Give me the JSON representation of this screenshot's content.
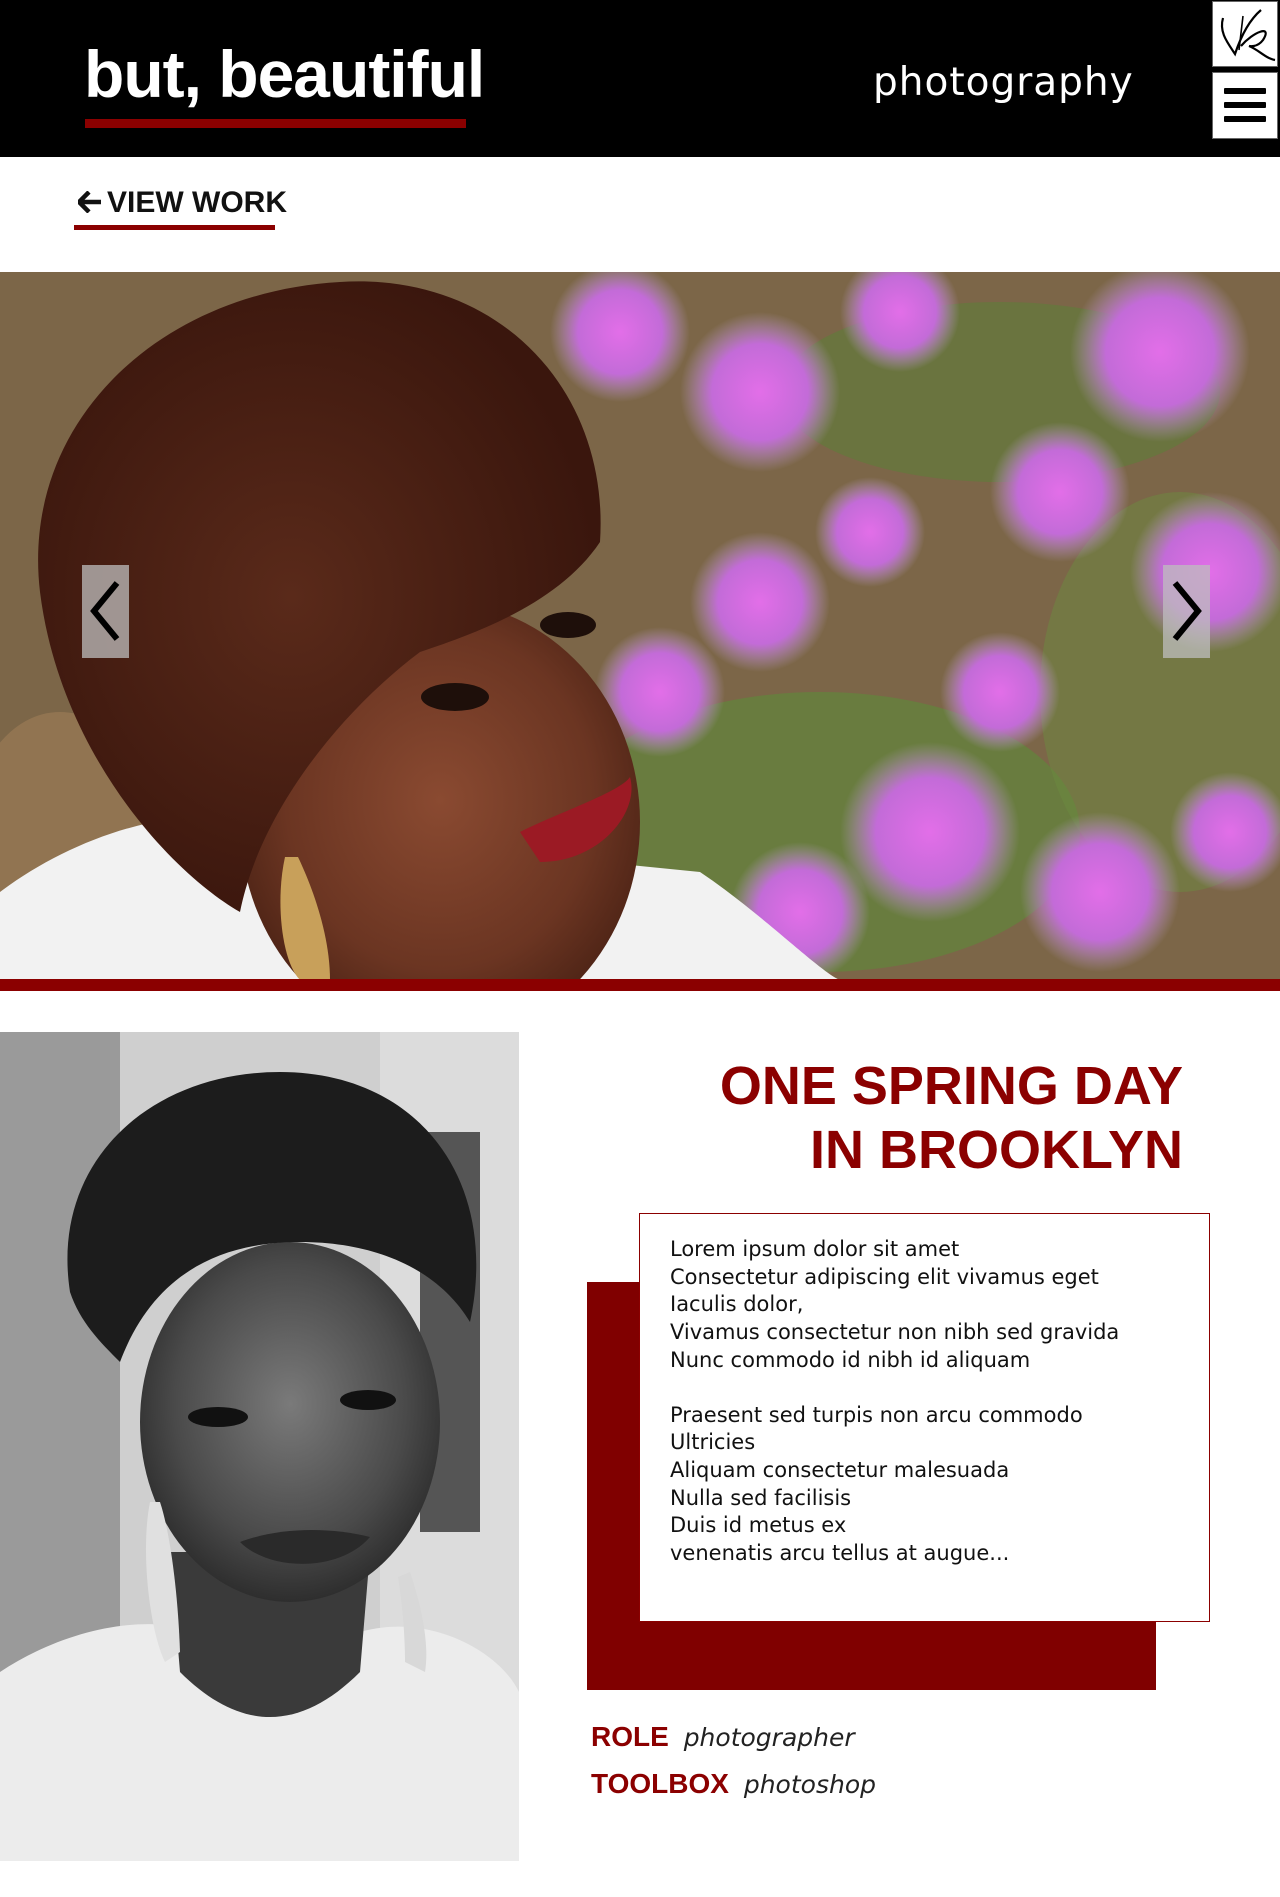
{
  "header": {
    "brand": "but, beautiful",
    "tagline": "photography",
    "logo_icon": "signature-logo-icon",
    "menu_icon": "hamburger-menu-icon"
  },
  "nav": {
    "back_label": "VIEW WORK"
  },
  "project": {
    "title_line1": "ONE SPRING DAY",
    "title_line2": "IN BROOKLYN",
    "description": {
      "paragraph1": [
        "Lorem ipsum dolor sit amet",
        "Consectetur adipiscing elit vivamus eget",
        "Iaculis dolor,",
        "Vivamus consectetur non nibh sed gravida",
        "Nunc commodo id nibh id aliquam"
      ],
      "paragraph2": [
        "Praesent sed turpis non arcu commodo",
        "Ultricies",
        "Aliquam consectetur malesuada",
        "Nulla sed facilisis",
        "Duis id metus ex",
        "venenatis arcu tellus at augue..."
      ]
    },
    "role_label": "ROLE",
    "role_value": "photographer",
    "toolbox_label": "TOOLBOX",
    "toolbox_value": "photoshop"
  },
  "carousel": {
    "prev_icon": "chevron-left-icon",
    "next_icon": "chevron-right-icon"
  },
  "colors": {
    "accent": "#8b0000",
    "header_bg": "#000000"
  }
}
